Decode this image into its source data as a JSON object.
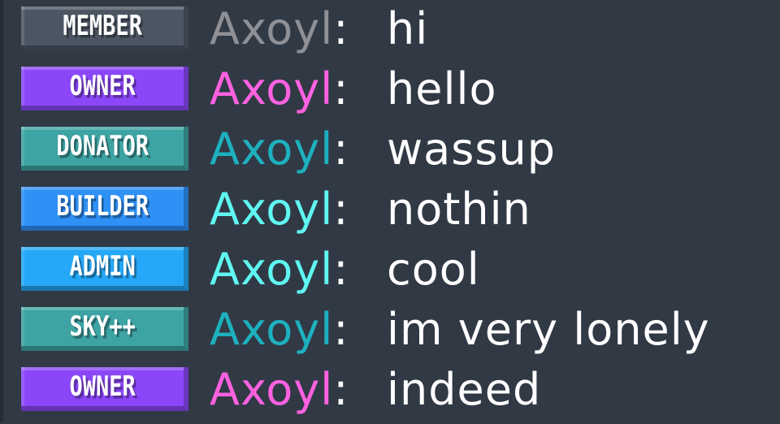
{
  "chat": {
    "messages": [
      {
        "rank": "MEMBER",
        "rank_color": "#4c5663",
        "name": "Axoyl",
        "name_color": "#8e9096",
        "separator": ":",
        "text": "hi"
      },
      {
        "rank": "OWNER",
        "rank_color": "#8b47f7",
        "name": "Axoyl",
        "name_color": "#ff61e1",
        "separator": ":",
        "text": "hello"
      },
      {
        "rank": "DONATOR",
        "rank_color": "#3ea3a3",
        "name": "Axoyl",
        "name_color": "#1db1bf",
        "separator": ":",
        "text": "wassup"
      },
      {
        "rank": "BUILDER",
        "rank_color": "#2f90f6",
        "name": "Axoyl",
        "name_color": "#5ff7f2",
        "separator": ":",
        "text": "nothin"
      },
      {
        "rank": "ADMIN",
        "rank_color": "#25a8f7",
        "name": "Axoyl",
        "name_color": "#5ff7f2",
        "separator": ":",
        "text": "cool"
      },
      {
        "rank": "SKY++",
        "rank_color": "#3ea3a3",
        "name": "Axoyl",
        "name_color": "#1db1bf",
        "separator": ":",
        "text": "im very lonely"
      },
      {
        "rank": "OWNER",
        "rank_color": "#8b47f7",
        "name": "Axoyl",
        "name_color": "#ff61e1",
        "separator": ":",
        "text": "indeed"
      }
    ]
  }
}
